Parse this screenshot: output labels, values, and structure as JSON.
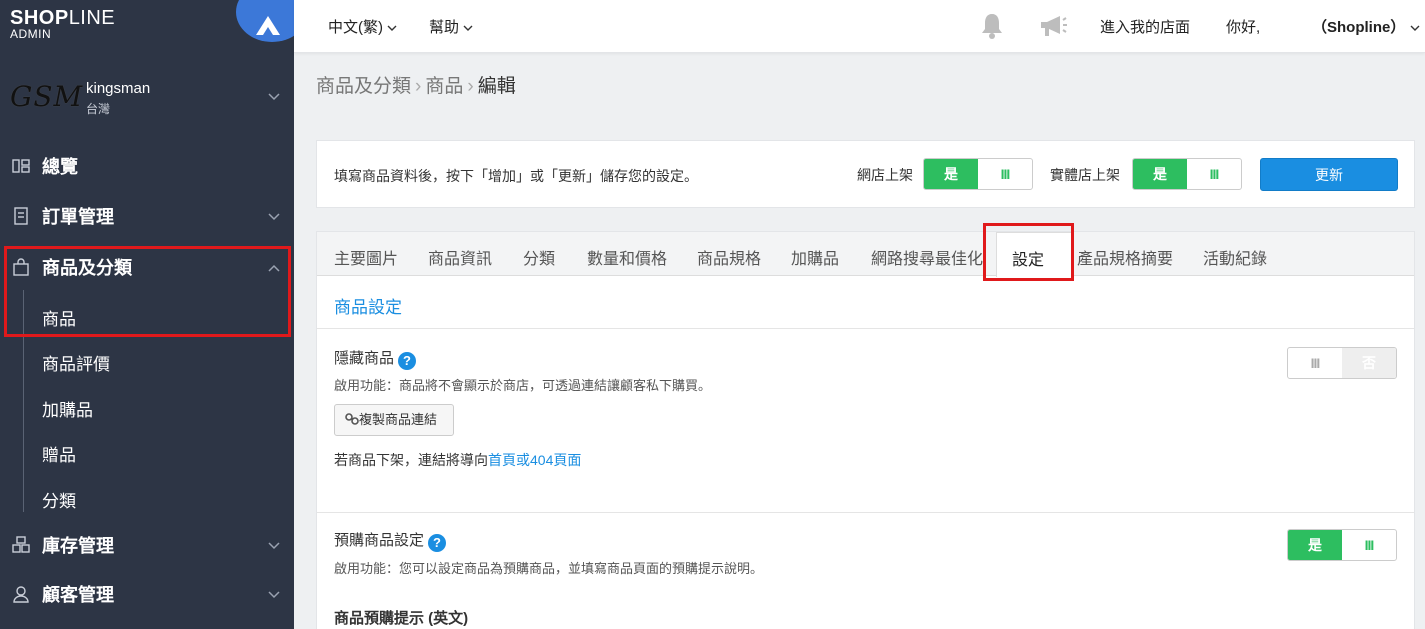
{
  "brand": {
    "logo_main": "SHOP",
    "logo_thin": "LINE",
    "logo_sub": "ADMIN"
  },
  "store": {
    "mark": "GSM",
    "name": "kingsman",
    "region": "台灣"
  },
  "sidebar": {
    "items": [
      {
        "label": "總覽",
        "icon": "dashboard-icon"
      },
      {
        "label": "訂單管理",
        "icon": "order-icon"
      },
      {
        "label": "商品及分類",
        "icon": "bag-icon"
      },
      {
        "label": "庫存管理",
        "icon": "inventory-icon"
      },
      {
        "label": "顧客管理",
        "icon": "user-icon"
      }
    ],
    "product_sub": [
      "商品",
      "商品評價",
      "加購品",
      "贈品",
      "分類"
    ]
  },
  "topbar": {
    "language": "中文(繁)",
    "help": "幫助",
    "enter_store": "進入我的店面",
    "greeting": "你好,",
    "account": "（Shopline）"
  },
  "breadcrumb": {
    "root": "商品及分類",
    "mid": "商品",
    "current": "編輯"
  },
  "info": {
    "message": "填寫商品資料後，按下「增加」或「更新」儲存您的設定。",
    "online_label": "網店上架",
    "retail_label": "實體店上架",
    "yes": "是",
    "bars": "III",
    "update": "更新"
  },
  "tabs": [
    "主要圖片",
    "商品資訊",
    "分類",
    "數量和價格",
    "商品規格",
    "加購品",
    "網路搜尋最佳化",
    "設定",
    "產品規格摘要",
    "活動紀錄"
  ],
  "settings": {
    "section_title": "商品設定",
    "hide": {
      "title": "隱藏商品",
      "desc": "啟用功能：商品將不會顯示於商店，可透過連結讓顧客私下購買。",
      "copy_button": "複製商品連結",
      "redirect_prefix": "若商品下架，連結將導向",
      "redirect_link": "首頁或404頁面",
      "toggle_bars": "III",
      "toggle_no": "否"
    },
    "preorder": {
      "title": "預購商品設定",
      "desc": "啟用功能：您可以設定商品為預購商品，並填寫商品頁面的預購提示說明。",
      "toggle_yes": "是",
      "toggle_bars": "III"
    },
    "preorder_hint_title": "商品預購提示 (英文)"
  }
}
